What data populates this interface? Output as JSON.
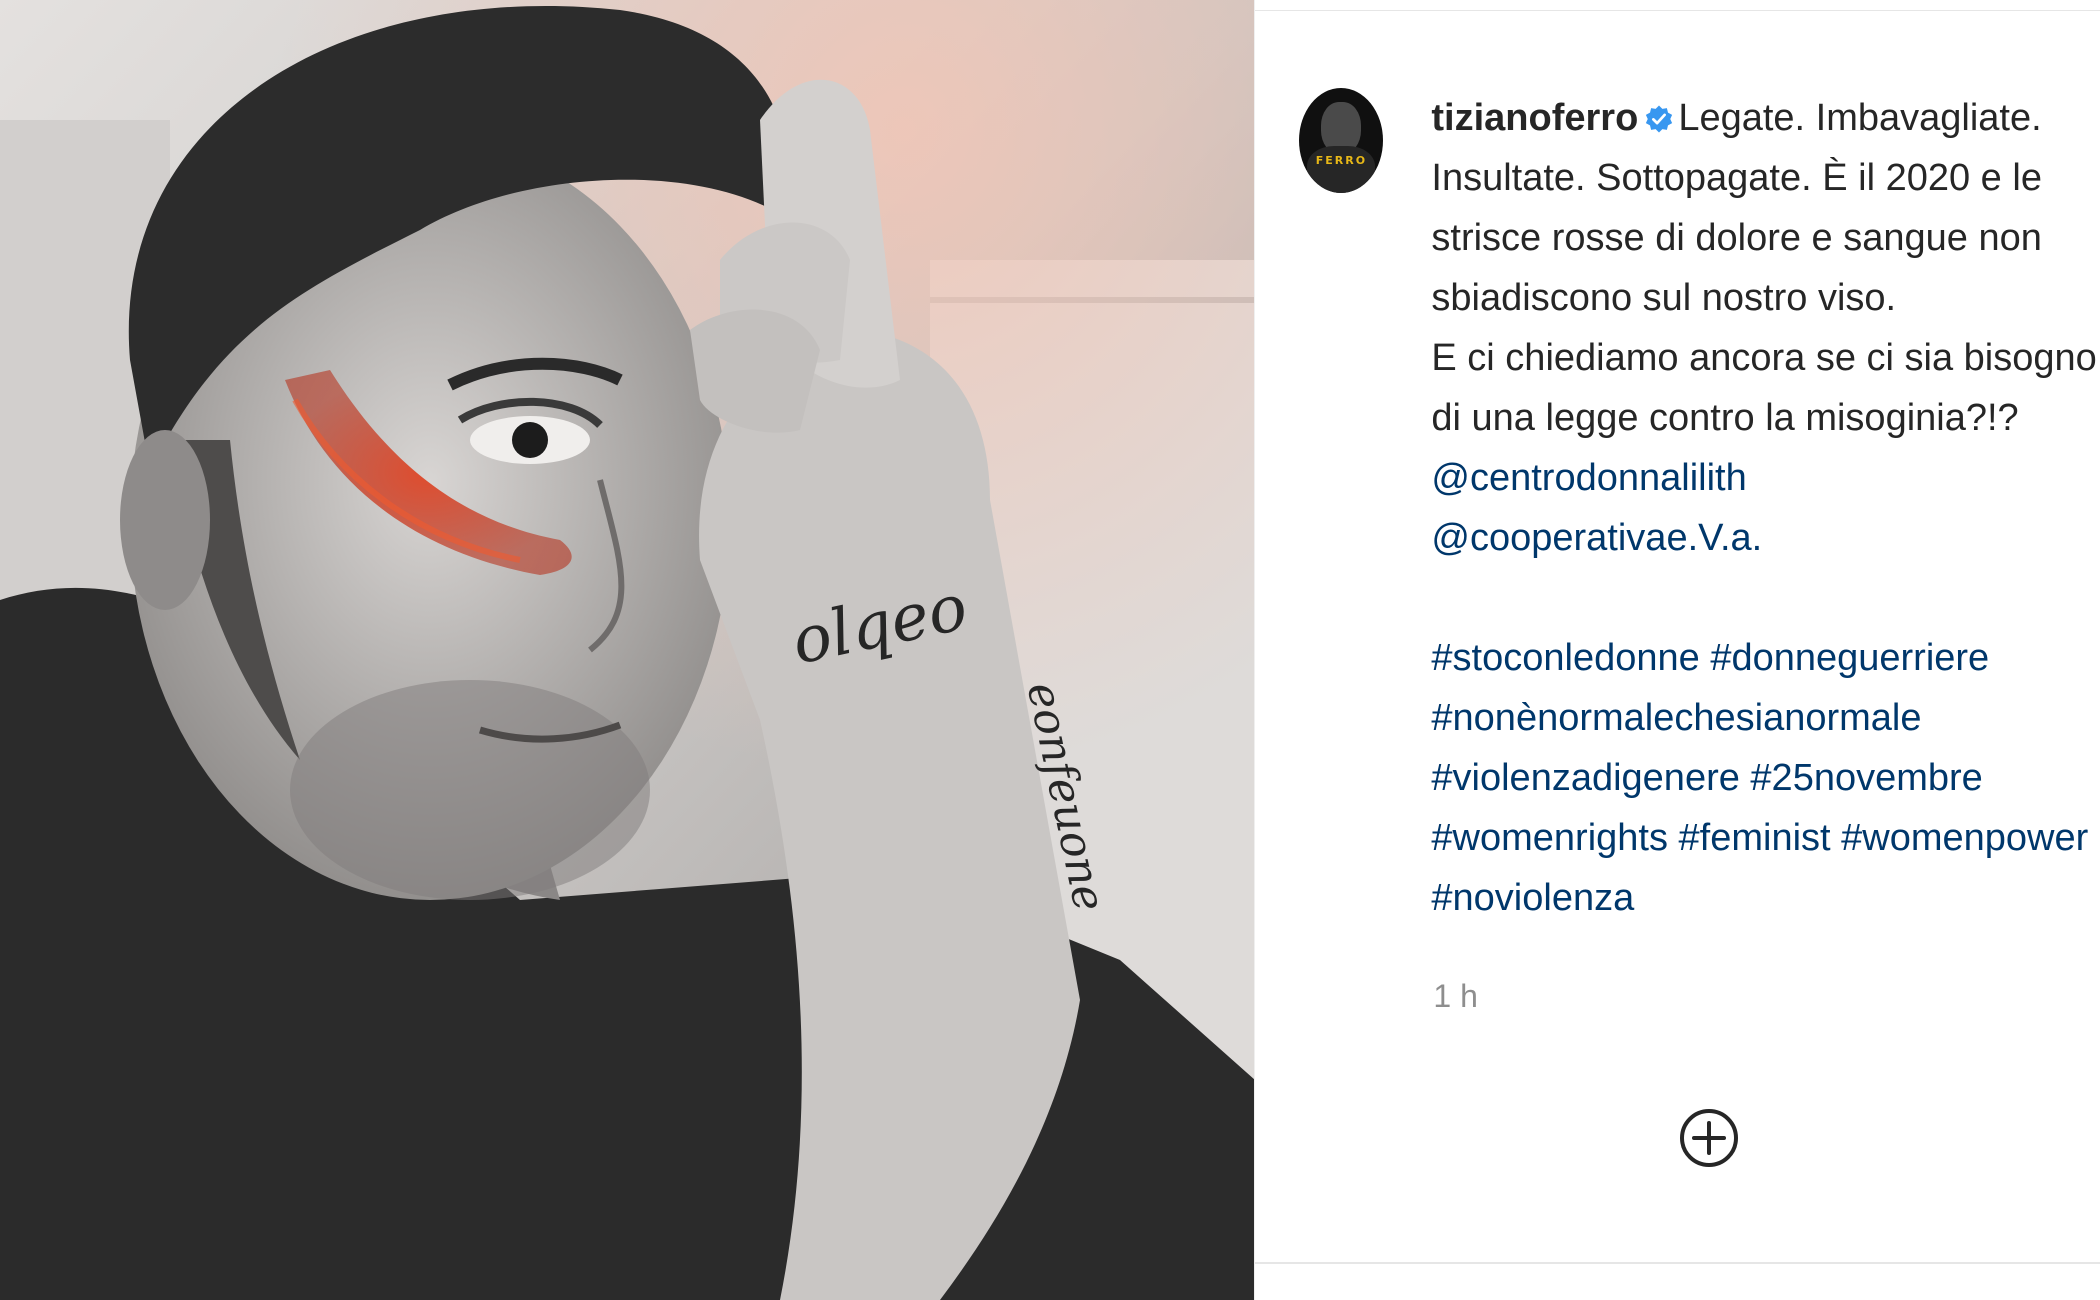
{
  "post": {
    "username": "tizianoferro",
    "avatar_brand": "FERRO",
    "caption_lines": [
      "Legate. Imbavagliate.",
      "Insultate. Sottopagate. È il 2020 e le",
      "strisce rosse di dolore e sangue non",
      "sbiadiscono sul nostro viso.",
      "E ci chiediamo ancora se ci sia bisogno",
      "di una legge contro la misoginia?!?"
    ],
    "mentions": [
      "@centrodonnalilith",
      "@cooperativae.V.a."
    ],
    "hashtag_lines": [
      [
        "#stoconledonne",
        "#donneguerriere"
      ],
      [
        "#nonènormalechesianormale"
      ],
      [
        "#violenzadigenere",
        "#25novembre"
      ],
      [
        "#womenrights",
        "#feminist",
        "#womenpower"
      ],
      [
        "#noviolenza"
      ]
    ],
    "timestamp": "1 h"
  },
  "icons": {
    "verified": "verified-badge-icon",
    "add": "plus-circle-icon"
  },
  "colors": {
    "link": "#00376b",
    "text": "#262626",
    "muted": "#8e8e8e",
    "verified": "#3897f0",
    "paint": "#d93a1c"
  }
}
